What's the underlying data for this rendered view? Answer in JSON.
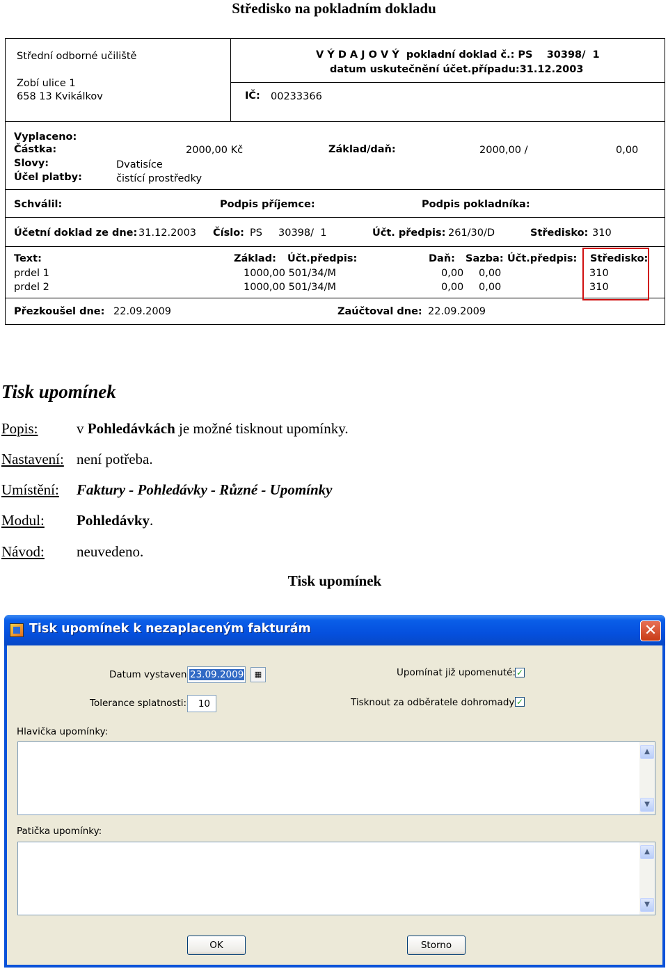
{
  "heading": "Středisko na pokladním dokladu",
  "receipt": {
    "org_name": "Střední odborné učiliště",
    "org_street": "Zobí ulice 1",
    "org_city": "658 13  Kvikálkov",
    "doc_title": "V Ý D A J O V Ý  pokladní doklad č.: PS    30398/  1",
    "doc_date": "datum uskutečnění účet.případu:31.12.2003",
    "ic_label": "IČ:",
    "ic_value": "00233366",
    "paid_label": "Vyplaceno:",
    "amount_label": "Částka:",
    "amount_value": "2000,00 Kč",
    "words_label": "Slovy:",
    "words_value": "Dvatisíce",
    "purpose_label": "Účel platby:",
    "purpose_value": "čistící prostředky",
    "base_tax_label": "Základ/daň:",
    "base_value": "2000,00 /",
    "tax_value": "0,00",
    "approved_label": "Schválil:",
    "recipient_sign_label": "Podpis příjemce:",
    "cashier_sign_label": "Podpis pokladníka:",
    "acc_doc_label": "Účetní doklad ze dne:",
    "acc_doc_date": "31.12.2003",
    "number_label": "Číslo:",
    "number_value": "PS     30398/  1",
    "acc_rule_label": "Účt. předpis:",
    "acc_rule_value": "261/30/D",
    "center_label": "Středisko:",
    "center_value": "310",
    "col_text": "Text:",
    "col_base": "Základ:",
    "col_rule": "Účt.předpis:",
    "col_tax": "Daň:",
    "col_rate": "Sazba:",
    "col_rule2": "Účt.předpis:",
    "col_center": "Středisko:",
    "rows": [
      {
        "text": "prdel 1",
        "base_rule": "1000,00 501/34/M",
        "tax": "0,00",
        "rate": "0,00",
        "center": "310"
      },
      {
        "text": "prdel 2",
        "base_rule": "1000,00 501/34/M",
        "tax": "0,00",
        "rate": "0,00",
        "center": "310"
      }
    ],
    "checked_label": "Přezkoušel dne:",
    "checked_date": "22.09.2009",
    "posted_label": "Zaúčtoval dne:",
    "posted_date": "22.09.2009",
    "highlight_color": "#d01010"
  },
  "section": {
    "title": "Tisk upomínek",
    "popis_label": "Popis:",
    "popis_prefix": "v ",
    "popis_bold": "Pohledávkách",
    "popis_rest": " je možné tisknout upomínky.",
    "nastaveni_label": "Nastavení:",
    "nastaveni_value": "není potřeba.",
    "umisteni_label": "Umístění:",
    "umisteni_value": "Faktury - Pohledávky - Různé - Upomínky",
    "modul_label": "Modul:",
    "modul_value": "Pohledávky",
    "modul_suffix": ".",
    "navod_label": "Návod:",
    "navod_value": "neuvedeno.",
    "caption": "Tisk upomínek"
  },
  "dialog": {
    "title": "Tisk upomínek k nezaplaceným fakturám",
    "close_glyph": "✕",
    "date_label": "Datum vystavení:",
    "date_value": "23.09.2009",
    "calendar_glyph": "▦",
    "tolerance_label": "Tolerance splatnosti:",
    "tolerance_value": "10",
    "remind_again_label": "Upomínat již upomenuté:",
    "remind_again_checked": true,
    "print_together_label": "Tisknout za odběratele dohromady:",
    "print_together_checked": true,
    "check_glyph": "✓",
    "header_label": "Hlavička upomínky:",
    "footer_label": "Patička upomínky:",
    "scroll_up": "▲",
    "scroll_down": "▼",
    "ok_label": "OK",
    "cancel_label": "Storno",
    "titlebar_color": "#0550de",
    "client_color": "#ece9d8"
  }
}
